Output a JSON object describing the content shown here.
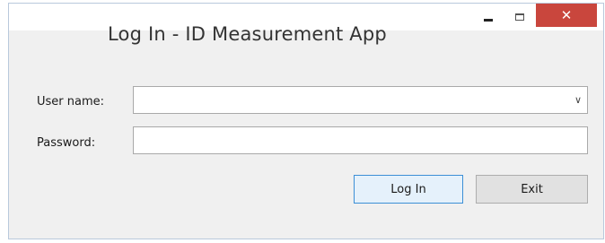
{
  "window": {
    "title": "Log In - ID Measurement App",
    "controls": {
      "minimize_icon": "minimize-icon",
      "maximize_icon": "maximize-icon",
      "close_icon": "close-icon",
      "close_glyph": "✕",
      "close_color": "#c9463d"
    }
  },
  "form": {
    "username": {
      "label": "User name:",
      "value": "",
      "dropdown_icon": "chevron-down-icon",
      "dropdown_glyph": "⌄"
    },
    "password": {
      "label": "Password:",
      "value": ""
    }
  },
  "buttons": {
    "login_label": "Log In",
    "exit_label": "Exit"
  }
}
